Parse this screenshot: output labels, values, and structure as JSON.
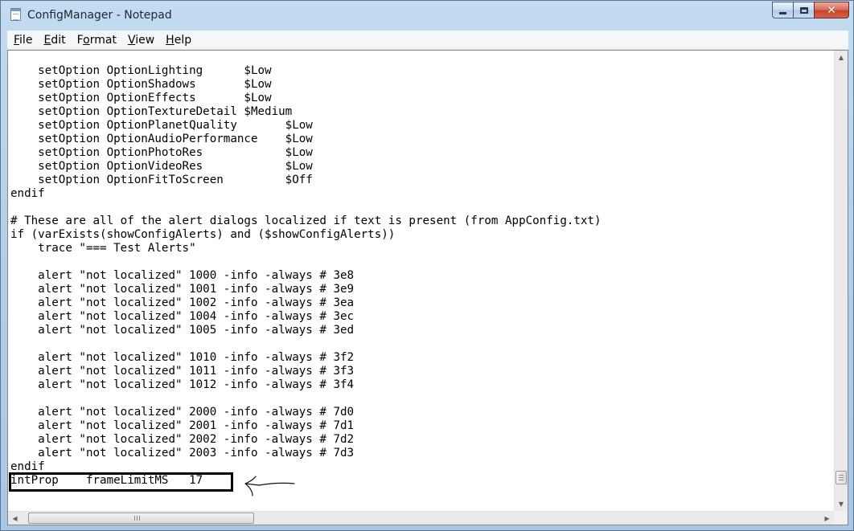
{
  "window": {
    "title": "ConfigManager - Notepad",
    "close_glyph": "✕"
  },
  "menu": {
    "items": [
      {
        "key": "F",
        "rest": "ile"
      },
      {
        "key": "E",
        "rest": "dit"
      },
      {
        "pre": "F",
        "key": "o",
        "rest": "rmat"
      },
      {
        "key": "V",
        "rest": "iew"
      },
      {
        "key": "H",
        "rest": "elp"
      }
    ]
  },
  "editor": {
    "lines": [
      "    setOption OptionLighting      $Low",
      "    setOption OptionShadows       $Low",
      "    setOption OptionEffects       $Low",
      "    setOption OptionTextureDetail $Medium",
      "    setOption OptionPlanetQuality       $Low",
      "    setOption OptionAudioPerformance    $Low",
      "    setOption OptionPhotoRes            $Low",
      "    setOption OptionVideoRes            $Low",
      "    setOption OptionFitToScreen         $Off",
      "endif",
      "",
      "# These are all of the alert dialogs localized if text is present (from AppConfig.txt)",
      "if (varExists(showConfigAlerts) and ($showConfigAlerts))",
      "    trace \"=== Test Alerts\"",
      "",
      "    alert \"not localized\" 1000 -info -always # 3e8",
      "    alert \"not localized\" 1001 -info -always # 3e9",
      "    alert \"not localized\" 1002 -info -always # 3ea",
      "    alert \"not localized\" 1004 -info -always # 3ec",
      "    alert \"not localized\" 1005 -info -always # 3ed",
      "",
      "    alert \"not localized\" 1010 -info -always # 3f2",
      "    alert \"not localized\" 1011 -info -always # 3f3",
      "    alert \"not localized\" 1012 -info -always # 3f4",
      "",
      "    alert \"not localized\" 2000 -info -always # 7d0",
      "    alert \"not localized\" 2001 -info -always # 7d1",
      "    alert \"not localized\" 2002 -info -always # 7d2",
      "    alert \"not localized\" 2003 -info -always # 7d3",
      "endif",
      "intProp    frameLimitMS   17"
    ]
  },
  "scrollbar": {
    "up_glyph": "▲",
    "down_glyph": "▼",
    "left_glyph": "◀",
    "right_glyph": "▶"
  }
}
